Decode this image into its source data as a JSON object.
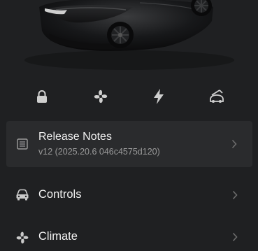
{
  "car_image": {
    "icon": "car-photo"
  },
  "quick_actions": [
    {
      "icon": "lock-icon"
    },
    {
      "icon": "fan-icon"
    },
    {
      "icon": "lightning-icon"
    },
    {
      "icon": "trunk-open-icon"
    }
  ],
  "release_notes": {
    "title": "Release Notes",
    "version": "v12 (2025.20.6 046c4575d120)"
  },
  "menu": {
    "items": [
      {
        "label": "Controls",
        "icon": "car-icon"
      },
      {
        "label": "Climate",
        "icon": "fan-icon"
      }
    ]
  },
  "colors": {
    "background": "#1f2022",
    "card": "#2a2b2d",
    "text_primary": "#f2f2f2",
    "text_secondary": "#9b9b9b"
  }
}
